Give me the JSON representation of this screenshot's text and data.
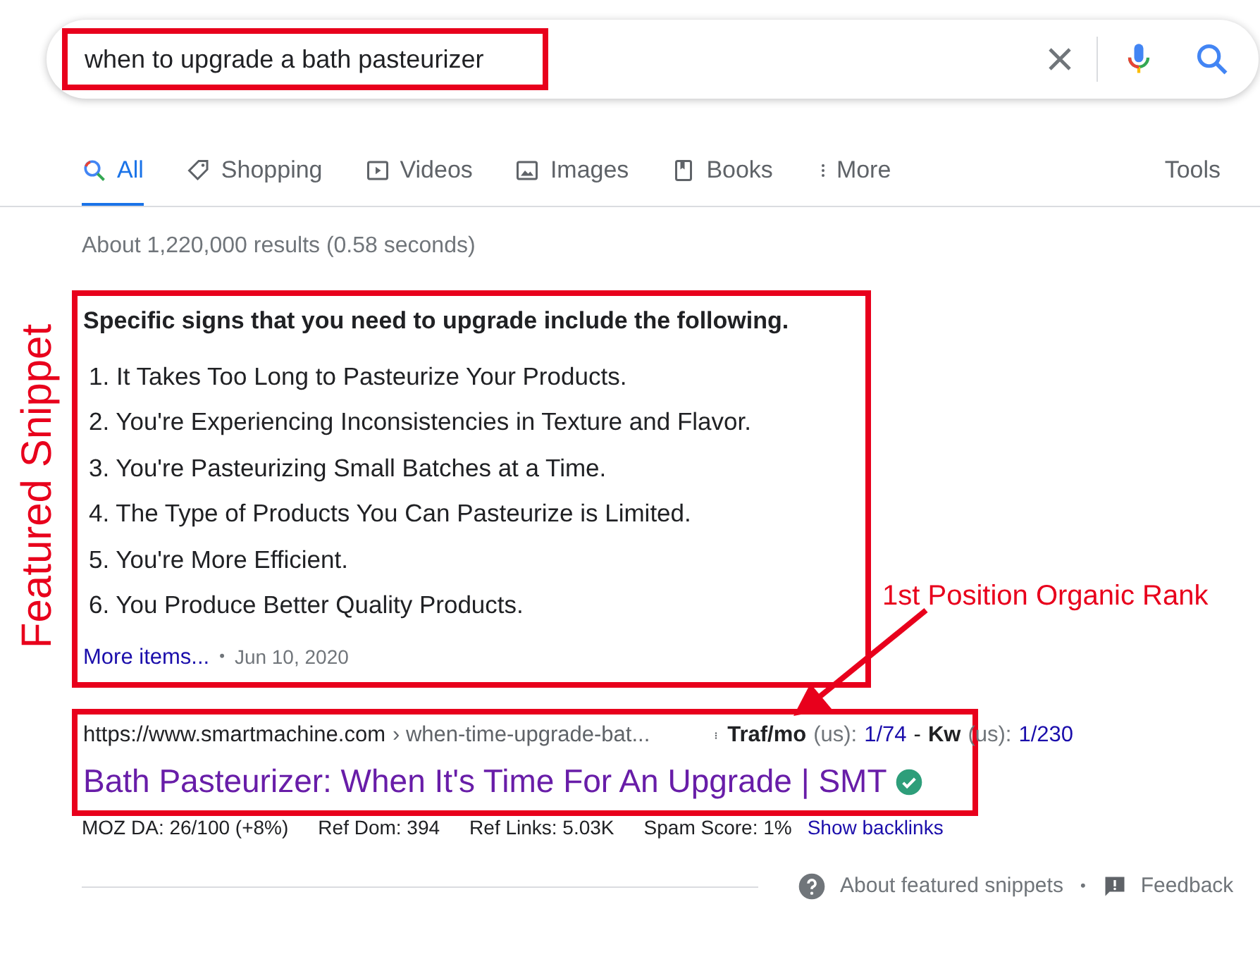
{
  "search": {
    "query": "when to upgrade a bath pasteurizer"
  },
  "tabs": [
    {
      "label": "All",
      "selected": true
    },
    {
      "label": "Shopping",
      "selected": false
    },
    {
      "label": "Videos",
      "selected": false
    },
    {
      "label": "Images",
      "selected": false
    },
    {
      "label": "Books",
      "selected": false
    },
    {
      "label": "More",
      "selected": false
    }
  ],
  "tools": "Tools",
  "result_stats": "About 1,220,000 results (0.58 seconds)",
  "featured_snippet": {
    "heading": "Specific signs that you need to upgrade include the following.",
    "items": [
      "1. It Takes Too Long to Pasteurize Your Products.",
      "2. You're Experiencing Inconsistencies in Texture and Flavor.",
      "3. You're Pasteurizing Small Batches at a Time.",
      "4. The Type of Products You Can Pasteurize is Limited.",
      "5. You're More Efficient.",
      "6. You Produce Better Quality Products."
    ],
    "more_link": "More items...",
    "separator": "•",
    "date": "Jun 10, 2020"
  },
  "result": {
    "url": "https://www.smartmachine.com",
    "breadcrumb": "› when-time-upgrade-bat...",
    "metrics": [
      {
        "label": "Traf/mo",
        "unit": "(us):",
        "value": "1/74"
      },
      {
        "label": "Kw",
        "unit": "(us):",
        "value": "1/230"
      }
    ],
    "metrics_separator": "-",
    "title": "Bath Pasteurizer: When It's Time For An Upgrade | SMT",
    "verified": true,
    "seo": [
      "MOZ DA: 26/100 (+8%)",
      "Ref Dom: 394",
      "Ref Links: 5.03K",
      "Spam Score: 1%"
    ],
    "backlinks_link": "Show backlinks"
  },
  "footer": {
    "about": "About featured snippets",
    "separator": "•",
    "feedback": "Feedback"
  },
  "annotations": [
    {
      "kind": "side-label",
      "text": "Featured Snippet"
    },
    {
      "kind": "arrow-label",
      "text": "1st Position Organic Rank"
    }
  ]
}
